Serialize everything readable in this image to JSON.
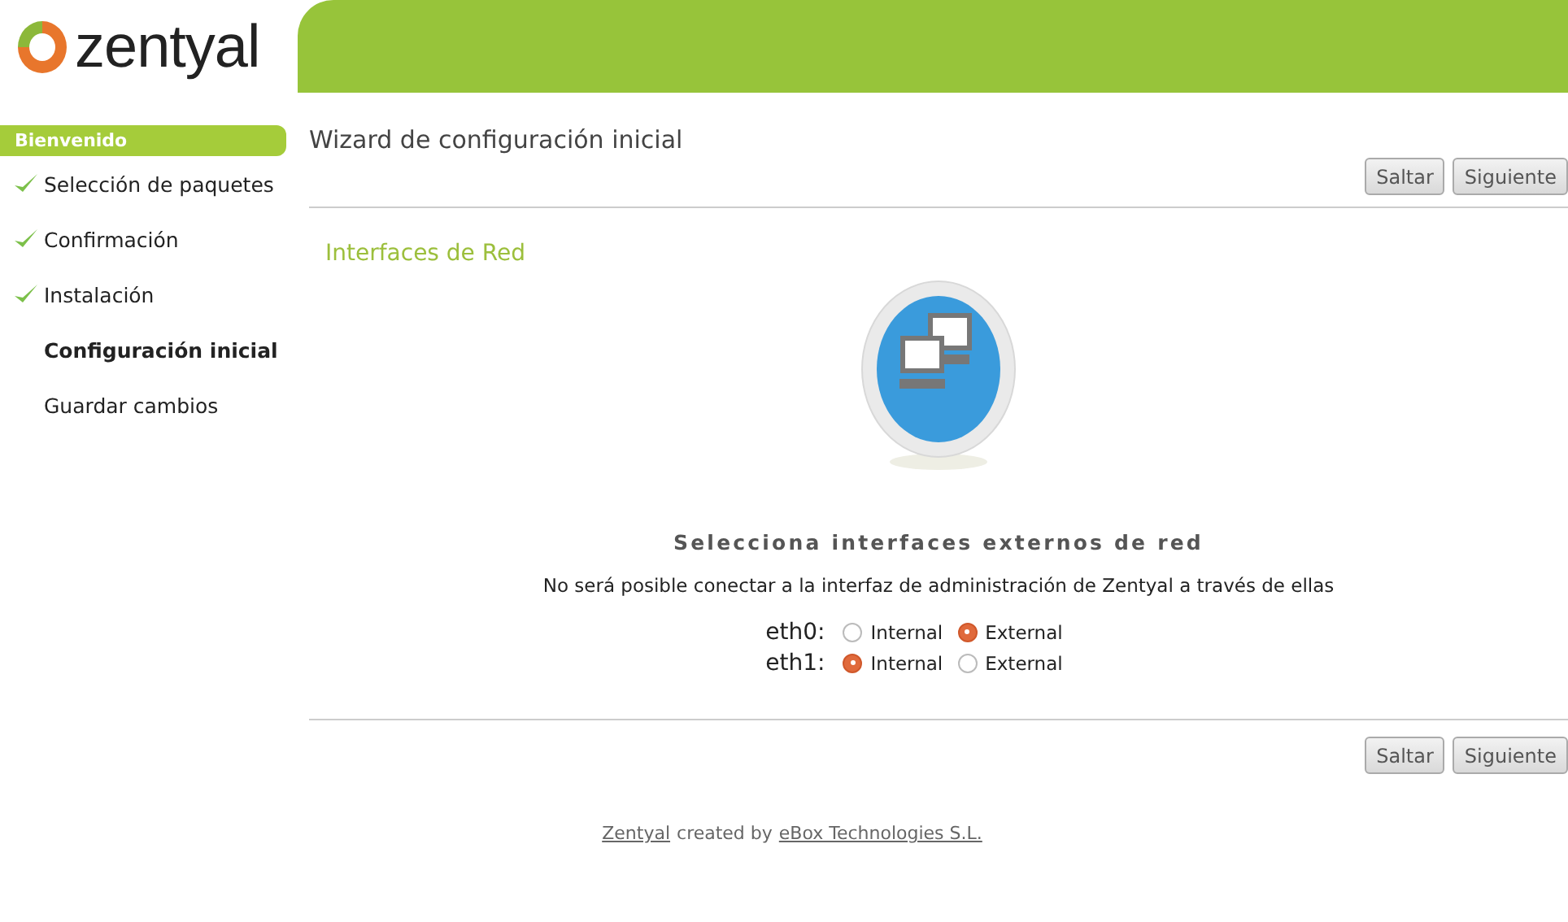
{
  "logo": {
    "text": "zentyal"
  },
  "sidebar": {
    "header": "Bienvenido",
    "steps": [
      {
        "label": "Selección de paquetes",
        "done": true,
        "current": false
      },
      {
        "label": "Confirmación",
        "done": true,
        "current": false
      },
      {
        "label": "Instalación",
        "done": true,
        "current": false
      },
      {
        "label": "Configuración inicial",
        "done": false,
        "current": true
      },
      {
        "label": "Guardar cambios",
        "done": false,
        "current": false
      }
    ]
  },
  "page_title": "Wizard de configuración inicial",
  "top_buttons": [
    "Saltar",
    "Siguiente"
  ],
  "section_title": "Interfaces de Red",
  "heading": "Selecciona interfaces externos de red",
  "description": "No será posible conectar a la interfaz de administración de Zentyal a través de ellas",
  "interfaces": [
    {
      "name": "eth0:",
      "options": [
        {
          "label": "Internal",
          "selected": false
        },
        {
          "label": "External",
          "selected": true
        }
      ]
    },
    {
      "name": "eth1:",
      "options": [
        {
          "label": "Internal",
          "selected": true
        },
        {
          "label": "External",
          "selected": false
        }
      ]
    }
  ],
  "bottom_buttons": [
    "Saltar",
    "Siguiente"
  ],
  "footer": {
    "link1": "Zentyal",
    "text": "created by",
    "link2": "eBox Technologies S.L."
  }
}
